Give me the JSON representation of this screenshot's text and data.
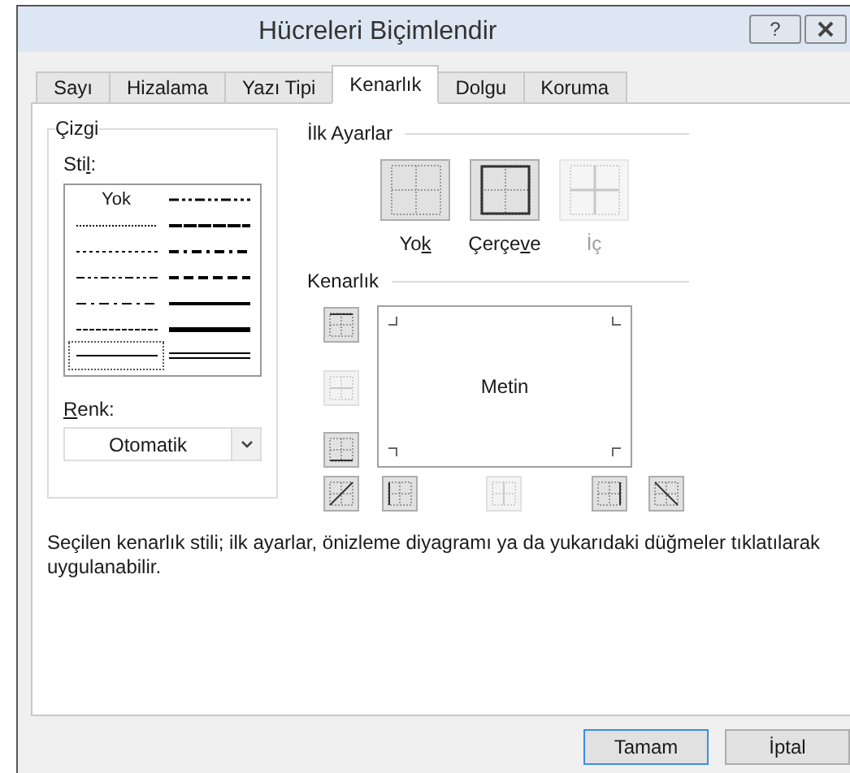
{
  "window": {
    "title": "Hücreleri Biçimlendir",
    "title_buttons": [
      {
        "kind": "help",
        "label": "?"
      },
      {
        "kind": "close"
      }
    ]
  },
  "tabs": [
    {
      "label": "Sayı",
      "selected": false
    },
    {
      "label": "Hizalama",
      "selected": false
    },
    {
      "label": "Yazı Tipi",
      "selected": false
    },
    {
      "label": "Kenarlık",
      "selected": true
    },
    {
      "label": "Dolgu",
      "selected": false
    },
    {
      "label": "Koruma",
      "selected": false
    }
  ],
  "line": {
    "title": "Çizgi",
    "style_label": {
      "pre": "Sti",
      "key": "l",
      "post": ":"
    },
    "styles": [
      {
        "kind": "none",
        "label": "Yok",
        "selected": false
      },
      {
        "kind": "dashdotdot",
        "selected": false
      },
      {
        "kind": "hair",
        "selected": false
      },
      {
        "kind": "slant",
        "selected": false
      },
      {
        "kind": "dotted",
        "selected": false
      },
      {
        "kind": "dashdot-medium",
        "selected": false
      },
      {
        "kind": "dashdotdot-thin",
        "selected": false
      },
      {
        "kind": "dashed-medium",
        "selected": false
      },
      {
        "kind": "dashdot-thin",
        "selected": false
      },
      {
        "kind": "solid-medium",
        "selected": false
      },
      {
        "kind": "dashed-thin",
        "selected": false
      },
      {
        "kind": "thick",
        "selected": false
      },
      {
        "kind": "solid-thin",
        "selected": true
      },
      {
        "kind": "double",
        "selected": false
      }
    ],
    "color_label": {
      "key": "R",
      "post": "enk:"
    },
    "color_value": "Otomatik"
  },
  "presets": {
    "title": "İlk Ayarlar",
    "items": [
      {
        "kind": "none",
        "label": {
          "pre": "Yo",
          "key": "k"
        },
        "disabled": false
      },
      {
        "kind": "outline",
        "label": {
          "pre": "Çerçe",
          "key": "v",
          "post": "e"
        },
        "disabled": false
      },
      {
        "kind": "inside",
        "label": {
          "pre": "İç"
        },
        "disabled": true
      }
    ]
  },
  "border": {
    "title": "Kenarlık",
    "preview_text": "Metin",
    "side_buttons": [
      {
        "kind": "top",
        "disabled": false
      },
      {
        "kind": "middle-h",
        "disabled": true
      },
      {
        "kind": "bottom",
        "disabled": false
      }
    ],
    "bottom_buttons": [
      {
        "kind": "diag-up",
        "disabled": false
      },
      {
        "kind": "left",
        "disabled": false
      },
      {
        "kind": "middle-v",
        "disabled": true
      },
      {
        "kind": "right",
        "disabled": false
      },
      {
        "kind": "diag-down",
        "disabled": false
      }
    ]
  },
  "description": "Seçilen kenarlık stili; ilk ayarlar, önizleme diyagramı ya da yukarıdaki düğmeler tıklatılarak uygulanabilir.",
  "buttons": [
    {
      "label": "Tamam",
      "default": true
    },
    {
      "label": "İptal",
      "default": false
    }
  ]
}
